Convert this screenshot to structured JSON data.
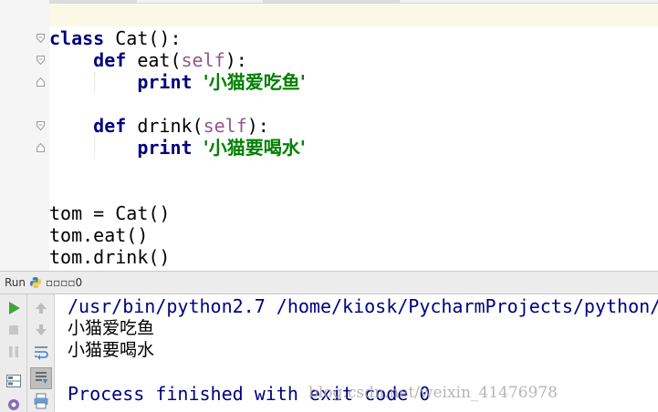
{
  "editor": {
    "lines": [
      {
        "indent": "",
        "parts": [
          {
            "t": "class",
            "c": "kw"
          },
          {
            "t": " Cat():",
            "c": ""
          }
        ]
      },
      {
        "indent": "    ",
        "parts": [
          {
            "t": "def",
            "c": "kw"
          },
          {
            "t": " eat(",
            "c": ""
          },
          {
            "t": "self",
            "c": "self"
          },
          {
            "t": "):",
            "c": ""
          }
        ]
      },
      {
        "indent": "        ",
        "parts": [
          {
            "t": "print",
            "c": "kw"
          },
          {
            "t": " ",
            "c": ""
          },
          {
            "t": "'小猫爱吃鱼'",
            "c": "str"
          }
        ]
      },
      {
        "indent": "",
        "parts": []
      },
      {
        "indent": "    ",
        "parts": [
          {
            "t": "def",
            "c": "kw"
          },
          {
            "t": " drink(",
            "c": ""
          },
          {
            "t": "self",
            "c": "self"
          },
          {
            "t": "):",
            "c": ""
          }
        ]
      },
      {
        "indent": "        ",
        "parts": [
          {
            "t": "print",
            "c": "kw"
          },
          {
            "t": " ",
            "c": ""
          },
          {
            "t": "'小猫要喝水'",
            "c": "str"
          }
        ]
      },
      {
        "indent": "",
        "parts": []
      },
      {
        "indent": "",
        "parts": []
      },
      {
        "indent": "",
        "parts": [
          {
            "t": "tom = Cat()",
            "c": ""
          }
        ]
      },
      {
        "indent": "",
        "parts": [
          {
            "t": "tom.eat()",
            "c": ""
          }
        ]
      },
      {
        "indent": "",
        "parts": [
          {
            "t": "tom.drink()",
            "c": ""
          }
        ]
      }
    ]
  },
  "run_panel": {
    "label": "Run",
    "config_name": "▫▫▫▫0",
    "console": {
      "command": "/usr/bin/python2.7 /home/kiosk/PycharmProjects/python/",
      "output": [
        "小猫爱吃鱼",
        "小猫要喝水"
      ],
      "finished": "Process finished with exit code 0",
      "watermark": "blog.csdn.net/weixin_41476978"
    }
  },
  "icons": {
    "run": "play-icon",
    "stop": "stop-icon",
    "pause": "pause-icon",
    "up": "arrow-up-icon",
    "down": "arrow-down-icon"
  },
  "colors": {
    "keyword": "#000080",
    "self": "#94558d",
    "string": "#008000",
    "run_green": "#3fa33f",
    "caret_line": "#fbf8e6"
  }
}
